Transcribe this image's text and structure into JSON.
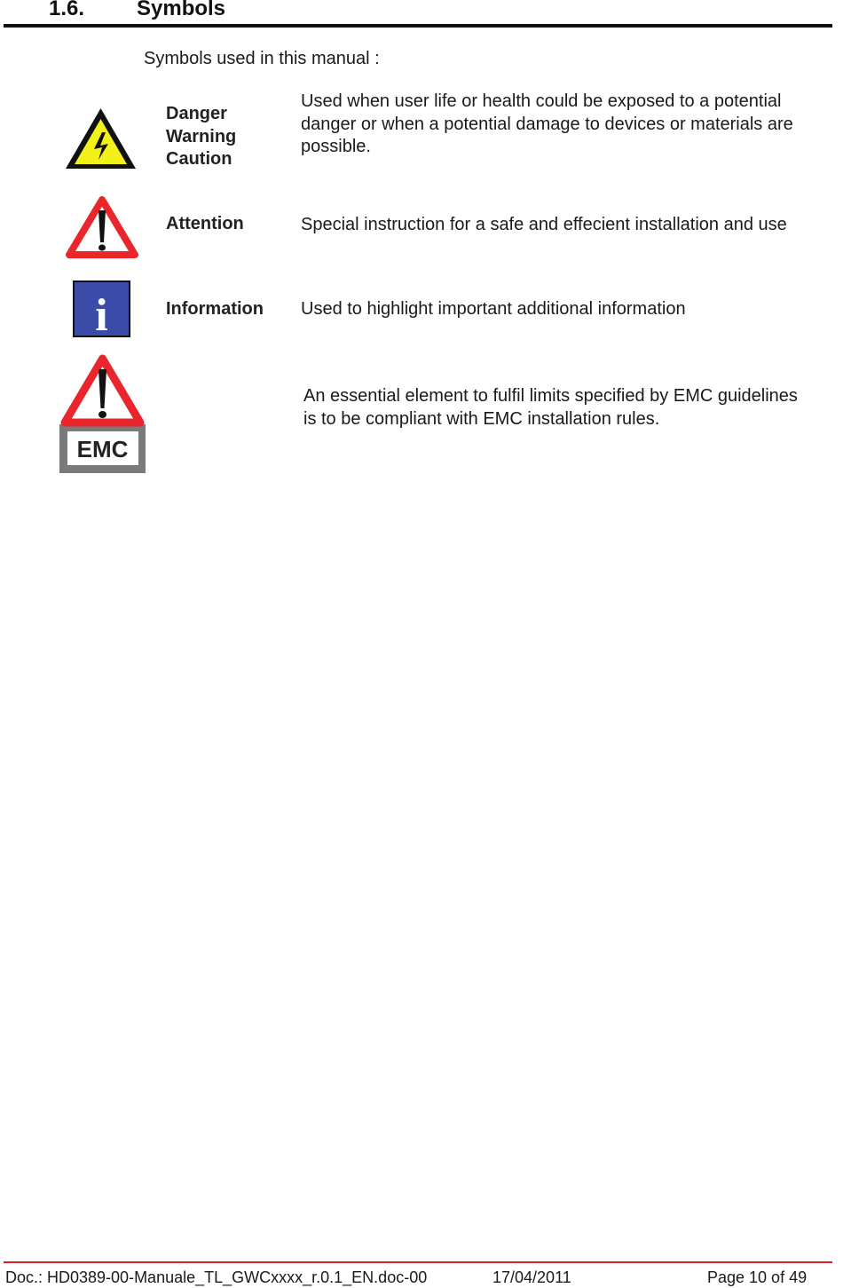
{
  "heading": {
    "number": "1.6.",
    "title": "Symbols"
  },
  "intro": "Symbols used in this manual :",
  "symbols": [
    {
      "icon": "high-voltage-warning-icon",
      "labels": [
        "Danger",
        "Warning",
        "Caution"
      ],
      "description_lines": [
        "Used when user life or health could be exposed to a potential",
        "danger or when a potential damage to devices or materials are",
        "possible."
      ]
    },
    {
      "icon": "attention-exclamation-icon",
      "labels": [
        "Attention"
      ],
      "description_lines": [
        "Special instruction for a safe and effecient installation and use"
      ]
    },
    {
      "icon": "information-icon",
      "icon_glyph": "i",
      "labels": [
        "Information"
      ],
      "description_lines": [
        "Used to highlight important additional information"
      ]
    },
    {
      "icon": "emc-warning-icon",
      "icon_text": "EMC",
      "labels": [],
      "description_lines": [
        "An essential element to fulfil limits specified by EMC guidelines",
        "is to be compliant with EMC installation rules."
      ]
    }
  ],
  "colors": {
    "danger_yellow": "#f2f21a",
    "attention_red": "#e8262b",
    "info_blue": "#3a4ca8",
    "emc_gray": "#7a7a7a",
    "footer_rule": "#d92128"
  },
  "footer": {
    "doc": "Doc.: HD0389-00-Manuale_TL_GWCxxxx_r.0.1_EN.doc-00",
    "date": "17/04/2011",
    "page": "Page 10 of 49"
  }
}
